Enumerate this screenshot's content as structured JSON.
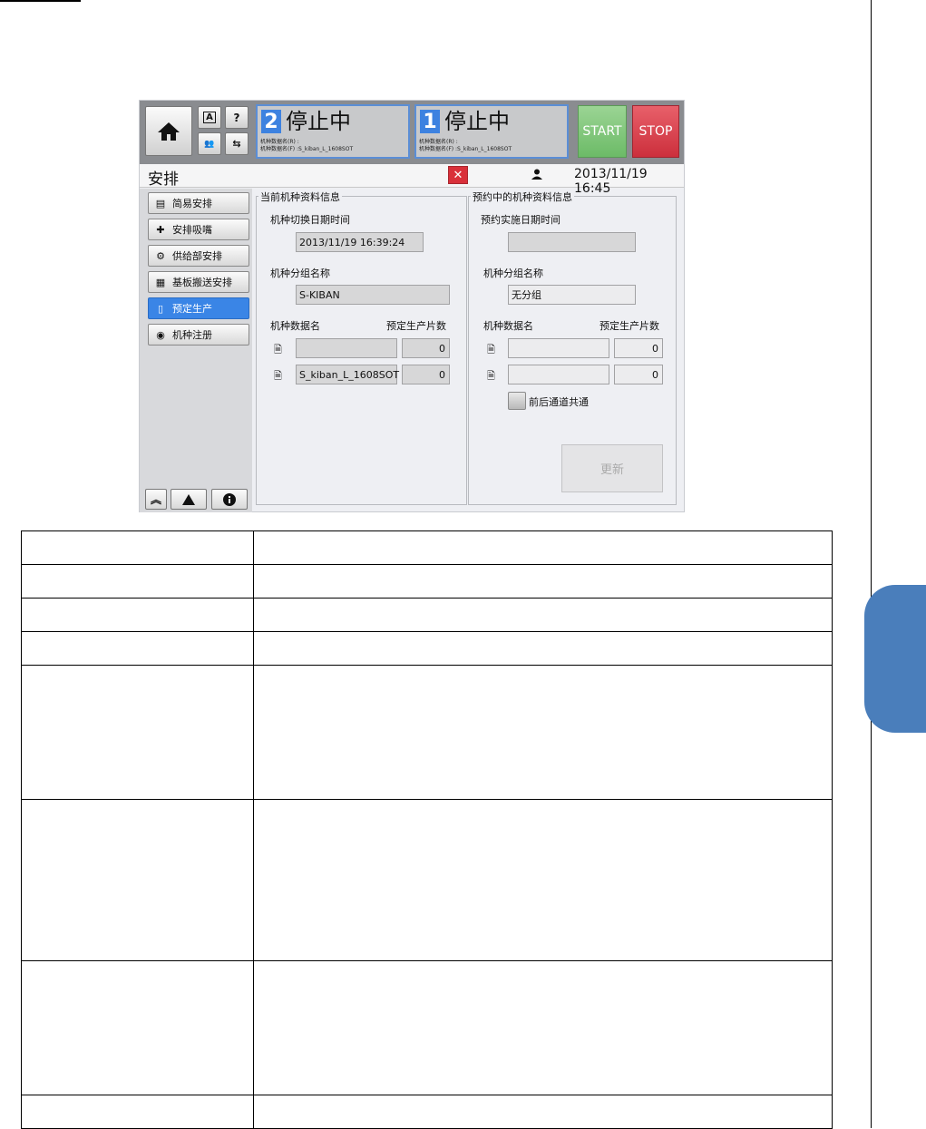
{
  "screen": {
    "topbar": {
      "small_btn_a": "A",
      "small_btn_help": "?",
      "lanes": [
        {
          "number": "2",
          "status": "停止中",
          "info_line1": "机种数据名(R) :",
          "info_line2": "机种数据名(F) :S_kiban_L_1608SOT"
        },
        {
          "number": "1",
          "status": "停止中",
          "info_line1": "机种数据名(R) :",
          "info_line2": "机种数据名(F) :S_kiban_L_1608SOT"
        }
      ],
      "start_label": "START",
      "stop_label": "STOP"
    },
    "titlebar": {
      "title": "安排",
      "close": "✕",
      "datetime": "2013/11/19 16:45"
    },
    "sidebar": {
      "items": [
        {
          "label": "简易安排",
          "icon": "list-icon",
          "active": false
        },
        {
          "label": "安排吸嘴",
          "icon": "nozzle-icon",
          "active": false
        },
        {
          "label": "供给部安排",
          "icon": "feeder-icon",
          "active": false
        },
        {
          "label": "基板搬送安排",
          "icon": "conveyor-icon",
          "active": false
        },
        {
          "label": "预定生产",
          "icon": "clipboard-icon",
          "active": true
        },
        {
          "label": "机种注册",
          "icon": "register-icon",
          "active": false
        }
      ]
    },
    "current": {
      "group_title": "当前机种资料信息",
      "switch_time_label": "机种切换日期时间",
      "switch_time_value": "2013/11/19 16:39:24",
      "group_name_label": "机种分组名称",
      "group_name_value": "S-KIBAN",
      "data_name_label": "机种数据名",
      "count_label": "预定生产片数",
      "rows": [
        {
          "name": "",
          "count": "0"
        },
        {
          "name": "S_kiban_L_1608SOT",
          "count": "0"
        }
      ]
    },
    "reserved": {
      "group_title": "预约中的机种资料信息",
      "exec_time_label": "预约实施日期时间",
      "exec_time_value": "",
      "group_name_label": "机种分组名称",
      "group_name_value": "无分组",
      "data_name_label": "机种数据名",
      "count_label": "预定生产片数",
      "rows": [
        {
          "name": "",
          "count": "0"
        },
        {
          "name": "",
          "count": "0"
        }
      ],
      "checkbox_label": "前后通道共通",
      "update_label": "更新"
    }
  },
  "colors": {
    "accent": "#3a85e6",
    "start": "#6cbb67",
    "stop": "#cc2f3c",
    "side_tab": "#4a7ebb"
  }
}
